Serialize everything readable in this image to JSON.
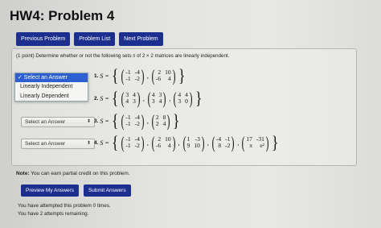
{
  "header": {
    "title": "HW4: Problem 4"
  },
  "nav": {
    "previous": "Previous Problem",
    "list": "Problem List",
    "next": "Next Problem"
  },
  "problem": {
    "instruction_prefix": "(1 point) Determine whether or not the following sets ",
    "instruction_var": "S",
    "instruction_suffix": " of 2 × 2 matrices are linearly independent.",
    "dropdown_options": [
      "✓ Select an Answer",
      "Linearly Independent",
      "Linearly Dependent"
    ],
    "closed_select_label": "Select an Answer",
    "set_label": "S =",
    "items": [
      {
        "num": "1.",
        "matrices": [
          [
            "-1",
            "-4",
            "-1",
            "-2"
          ],
          [
            "2",
            "10",
            "-6",
            "4"
          ]
        ]
      },
      {
        "num": "2.",
        "matrices": [
          [
            "3",
            "4",
            "4",
            "3"
          ],
          [
            "4",
            "3",
            "3",
            "4"
          ],
          [
            "4",
            "4",
            "3",
            "0"
          ]
        ]
      },
      {
        "num": "3.",
        "matrices": [
          [
            "-1",
            "-4",
            "-1",
            "-2"
          ],
          [
            "2",
            "8",
            "2",
            "4"
          ]
        ]
      },
      {
        "num": "4.",
        "matrices": [
          [
            "-1",
            "-4",
            "-1",
            "-2"
          ],
          [
            "2",
            "10",
            "-6",
            "4"
          ],
          [
            "1",
            "-3",
            "9",
            "10"
          ],
          [
            "-4",
            "-1",
            "8",
            "-2"
          ],
          [
            "17",
            "-31",
            "π",
            "e²"
          ]
        ]
      }
    ]
  },
  "footer": {
    "note_bold": "Note:",
    "note_text": " You can earn partial credit on this problem.",
    "preview": "Preview My Answers",
    "submit": "Submit Answers",
    "attempted": "You have attempted this problem 0 times.",
    "remaining": "You have 2 attempts remaining."
  }
}
